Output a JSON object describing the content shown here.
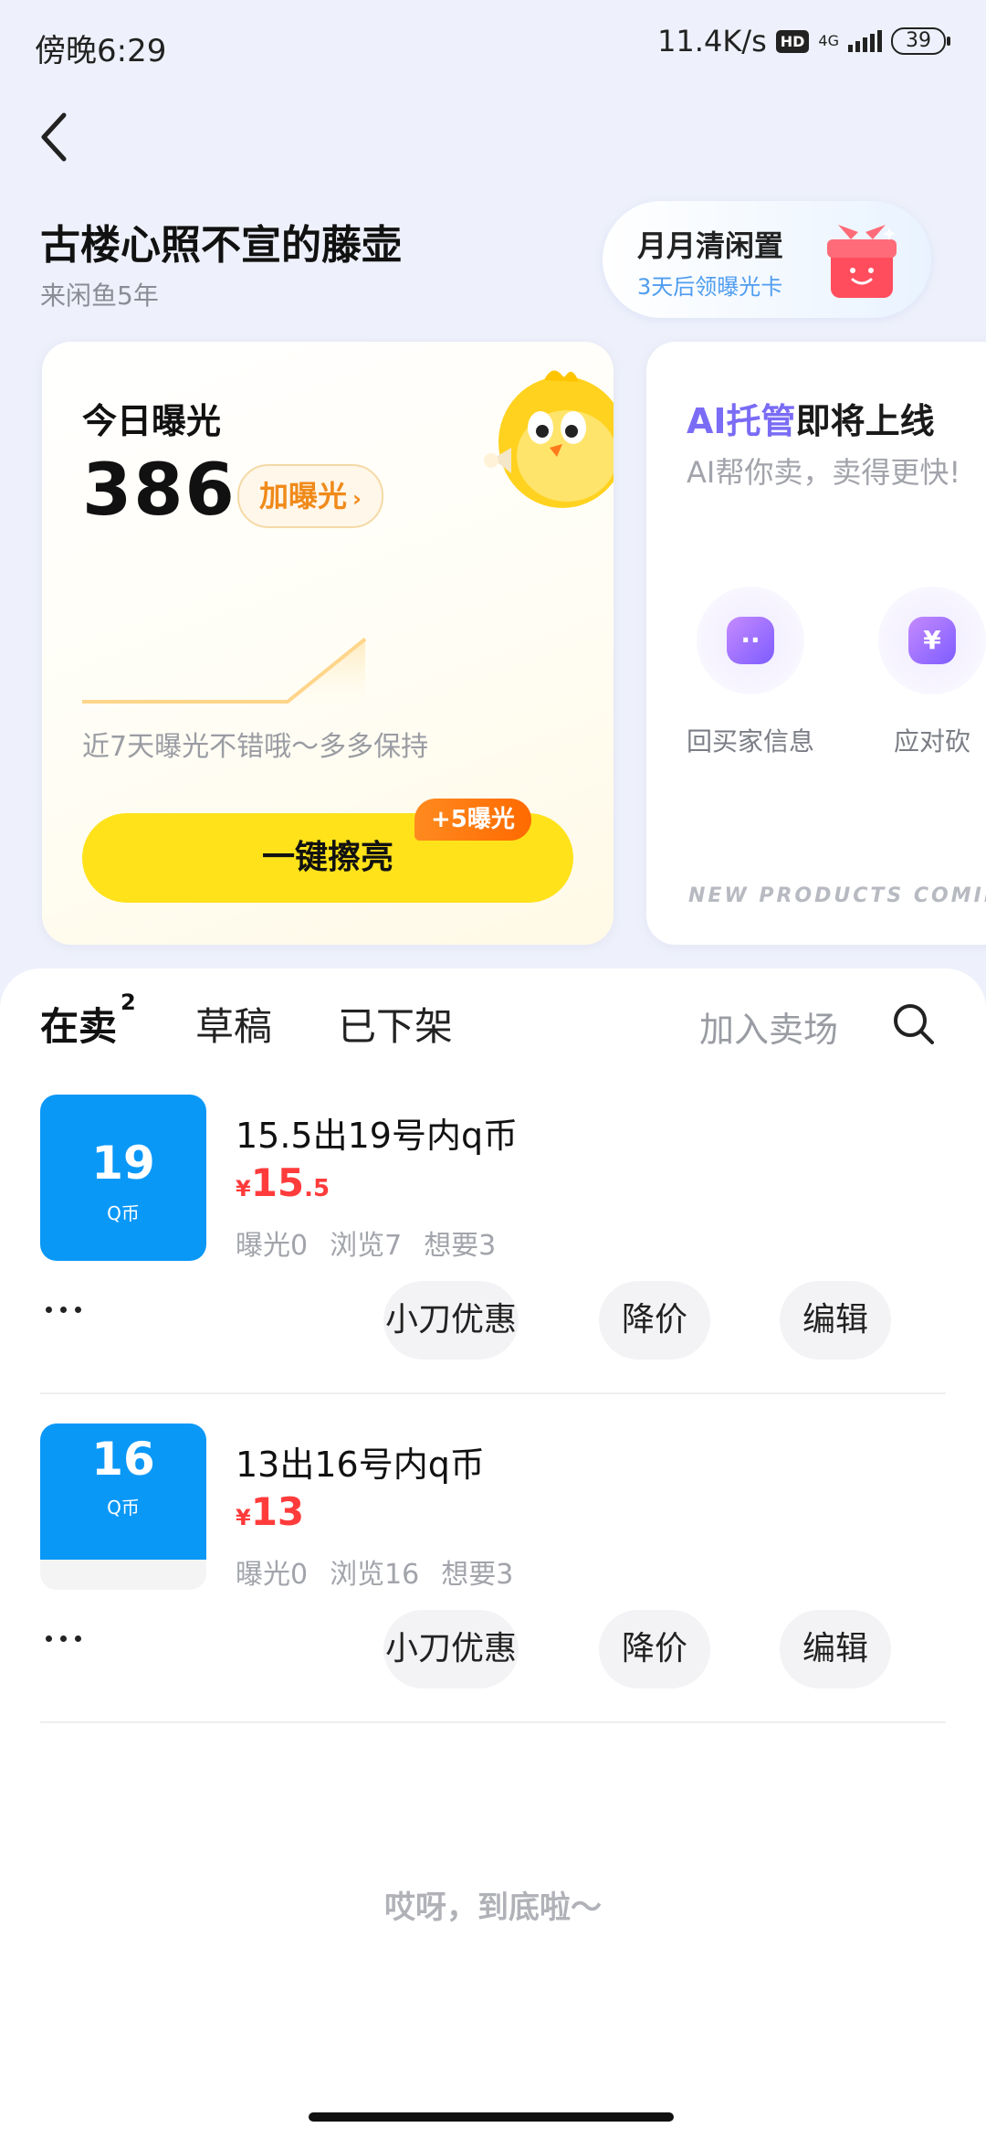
{
  "status_bar": {
    "time": "傍晚6:29",
    "net_speed": "11.4K/s",
    "hd": "HD",
    "network": "4G",
    "battery": "39"
  },
  "header": {
    "user_name": "古楼心照不宣的藤壶",
    "user_sub": "来闲鱼5年",
    "promo": {
      "title": "月月清闲置",
      "sub": "3天后领曝光卡"
    }
  },
  "exposure": {
    "title": "今日曝光",
    "value": "386",
    "boost_label": "加曝光",
    "note": "近7天曝光不错哦～多多保持",
    "polish_label": "一键擦亮",
    "polish_badge": "+5曝光",
    "trend": [
      0,
      0,
      0,
      0,
      0,
      0,
      1
    ]
  },
  "ai_card": {
    "title_ai": "AI托管",
    "title_rest": "即将上线",
    "sub": "AI帮你卖，卖得更快!",
    "features": [
      {
        "label": "回买家信息",
        "icon": "chat-bubble-icon"
      },
      {
        "label": "应对砍",
        "icon": "yuan-icon"
      }
    ],
    "footer": "NEW PRODUCTS COMING S"
  },
  "tabs": {
    "selling": "在卖",
    "selling_count": "2",
    "draft": "草稿",
    "offline": "已下架",
    "join": "加入卖场"
  },
  "items": [
    {
      "thumb_num": "19",
      "thumb_cur": "Q币",
      "title": "15.5出19号内q币",
      "price_yen": "¥",
      "price_int": "15",
      "price_dec": ".5",
      "stats": [
        "曝光0",
        "浏览7",
        "想要3"
      ],
      "actions": [
        "小刀优惠",
        "降价",
        "编辑"
      ]
    },
    {
      "thumb_num": "16",
      "thumb_cur": "Q币",
      "title": "13出16号内q币",
      "price_yen": "¥",
      "price_int": "13",
      "price_dec": "",
      "stats": [
        "曝光0",
        "浏览16",
        "想要3"
      ],
      "actions": [
        "小刀优惠",
        "降价",
        "编辑"
      ]
    }
  ],
  "end_text": "哎呀，到底啦～",
  "colors": {
    "accent_yellow": "#ffe21a",
    "price_red": "#ff3b3b",
    "thumb_blue": "#0a98f7",
    "boost_orange": "#f08a1a"
  }
}
